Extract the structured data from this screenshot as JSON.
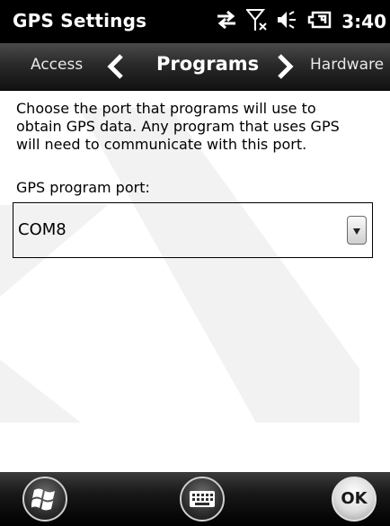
{
  "title_bar": {
    "app_title": "GPS Settings",
    "time": "3:40",
    "icons": [
      "sync-icon",
      "no-signal-icon",
      "volume-icon",
      "battery-icon"
    ]
  },
  "tabs": {
    "previous": "Access",
    "current": "Programs",
    "next": "Hardware"
  },
  "content": {
    "description_lines": [
      "Choose the port that programs will use to",
      "obtain GPS data. Any program that uses GPS",
      "will need to communicate with this port."
    ],
    "port_label": "GPS program port:",
    "port_value": "COM8"
  },
  "bottom_bar": {
    "ok_label": "OK",
    "icons": [
      "windows-start-icon",
      "keyboard-icon"
    ]
  }
}
